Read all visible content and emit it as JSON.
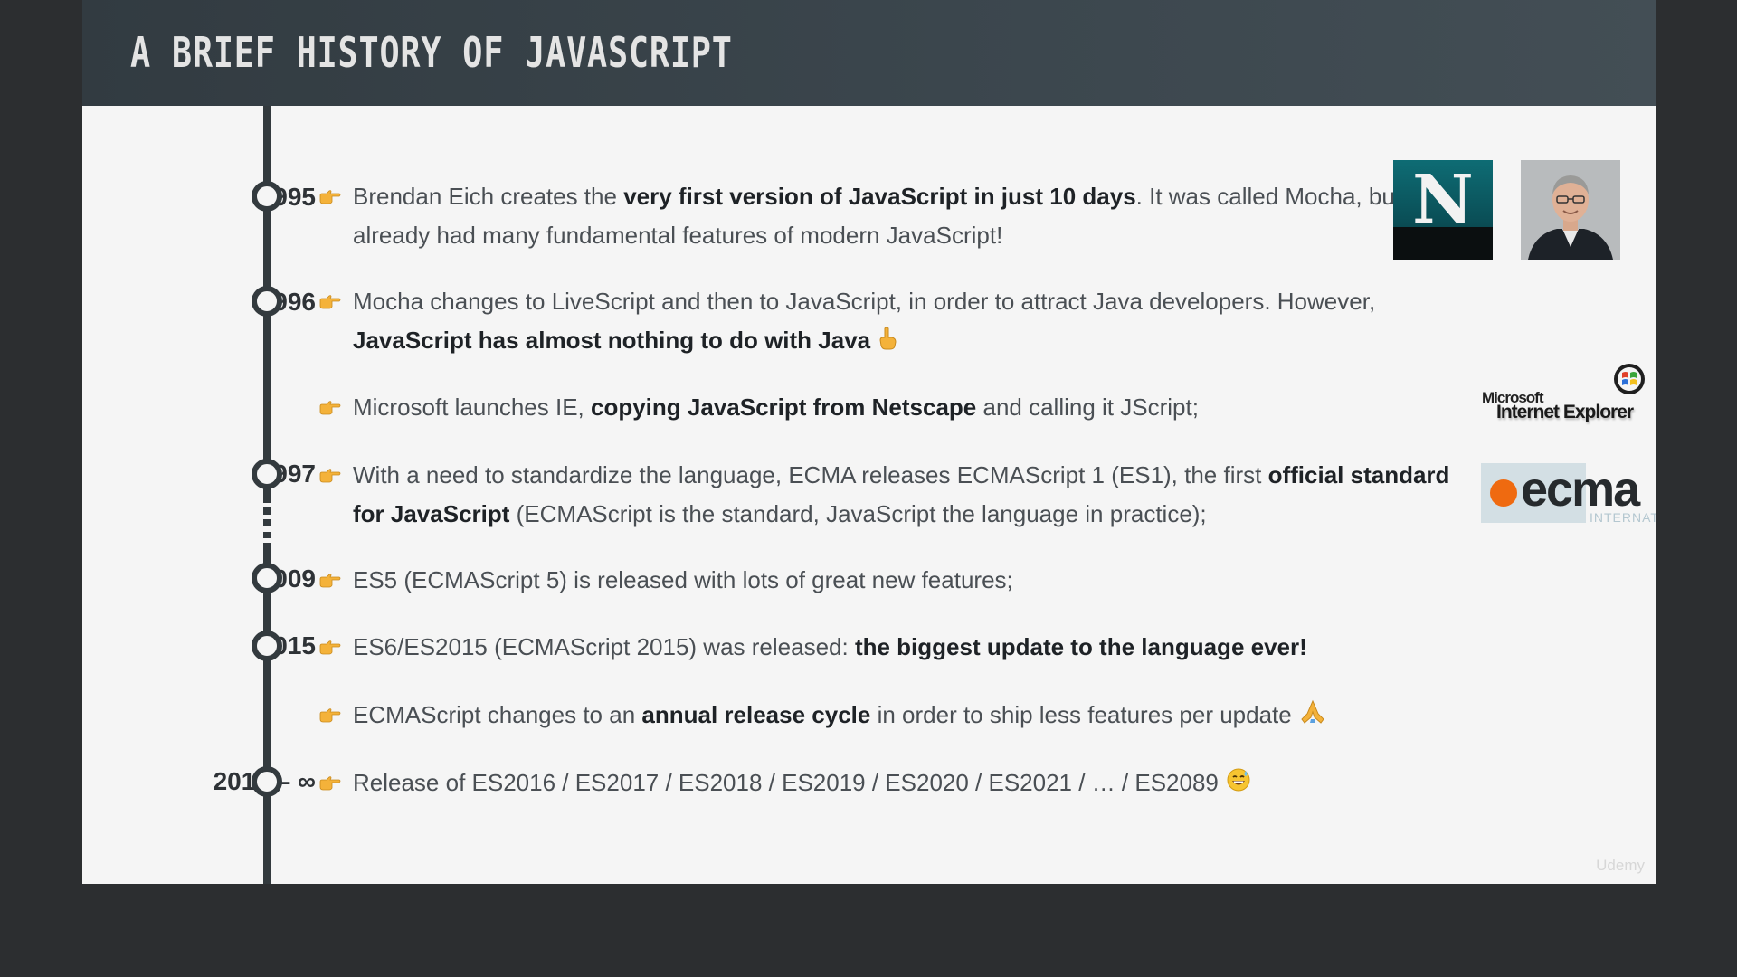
{
  "slide": {
    "title": "A BRIEF HISTORY OF JAVASCRIPT",
    "watermark": "Udemy"
  },
  "timeline": {
    "years": [
      "1995",
      "1996",
      "1997",
      "2009",
      "2015",
      "2016 – ∞"
    ],
    "entries": [
      {
        "parts": [
          {
            "t": "Brendan Eich creates the "
          },
          {
            "t": "very first version of JavaScript in just 10 days",
            "b": true
          },
          {
            "t": ". It was called Mocha, but already had many fundamental features of modern JavaScript!"
          }
        ]
      },
      {
        "parts": [
          {
            "t": "Mocha changes to LiveScript and then to JavaScript, in order to attract Java developers. However, "
          },
          {
            "t": "JavaScript has almost nothing to do with Java",
            "b": true
          }
        ],
        "emoji": "pointing-up-hand-icon"
      },
      {
        "parts": [
          {
            "t": "Microsoft launches IE, "
          },
          {
            "t": "copying JavaScript from Netscape",
            "b": true
          },
          {
            "t": " and calling it JScript;"
          }
        ]
      },
      {
        "parts": [
          {
            "t": "With a need to standardize the language, ECMA releases ECMAScript 1 (ES1), the first "
          },
          {
            "t": "official standard for JavaScript",
            "b": true
          },
          {
            "t": " (ECMAScript is the standard, JavaScript the language in practice);"
          }
        ]
      },
      {
        "parts": [
          {
            "t": "ES5 (ECMAScript 5) is released with lots of great new features;"
          }
        ]
      },
      {
        "parts": [
          {
            "t": "ES6/ES2015 (ECMAScript 2015) was released: "
          },
          {
            "t": "the biggest update to the language ever!",
            "b": true
          }
        ]
      },
      {
        "parts": [
          {
            "t": "ECMAScript changes to an "
          },
          {
            "t": "annual release cycle",
            "b": true
          },
          {
            "t": " in order to ship less features per update"
          }
        ],
        "emoji": "folded-hands-icon"
      },
      {
        "parts": [
          {
            "t": "Release of ES2016 / ES2017 / ES2018 / ES2019 / ES2020 / ES2021 / … / ES2089"
          }
        ],
        "emoji": "grinning-sweat-face-icon"
      }
    ]
  },
  "logos": {
    "netscape_letter": "N",
    "ie_brand_small": "Microsoft",
    "ie_brand_large": "Internet Explorer",
    "ecma_word": "ecma",
    "ecma_sub": "INTERNATIONAL"
  },
  "colors": {
    "header": "#37424a",
    "timeline": "#333a3e",
    "bullet": "#f4b23a",
    "ecma_orange": "#ef6a10",
    "netscape_teal": "#0b5c64"
  },
  "icons": {
    "bullet": "pointing-right-hand-icon",
    "timeline_node": "ring-icon"
  }
}
